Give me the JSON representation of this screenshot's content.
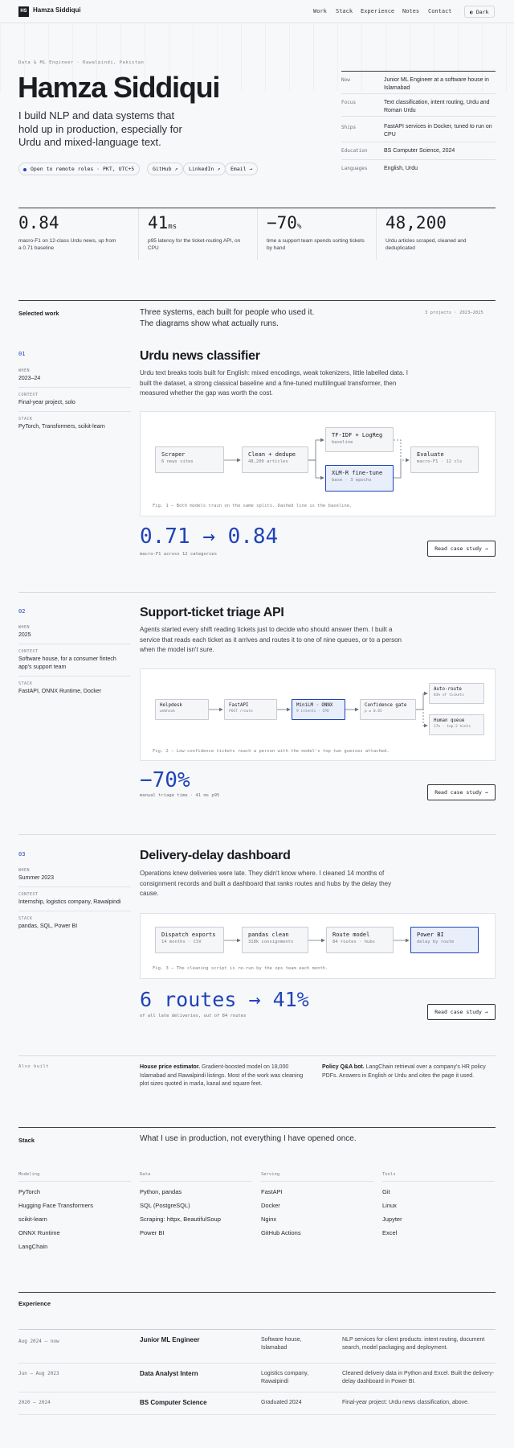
{
  "nav": {
    "logo": "HS",
    "brand": "Hamza Siddiqui",
    "links": [
      "Work",
      "Stack",
      "Experience",
      "Notes",
      "Contact"
    ],
    "theme_toggle": "Dark",
    "active": "Contact"
  },
  "hero": {
    "eyebrow": "Data & ML Engineer · Rawalpindi, Pakistan",
    "name": "Hamza Siddiqui",
    "tagline": "I build NLP and data systems that hold up in production, especially for Urdu and mixed-language text.",
    "status_pill": "Open to remote roles · PKT, UTC+5",
    "links": [
      "GitHub ↗",
      "LinkedIn ↗",
      "Email →"
    ],
    "facts": [
      {
        "k": "Now",
        "v": "Junior ML Engineer at a software house in Islamabad"
      },
      {
        "k": "Focus",
        "v": "Text classification, intent routing, Urdu and Roman Urdu"
      },
      {
        "k": "Ships",
        "v": "FastAPI services in Docker, tuned to run on CPU"
      },
      {
        "k": "Education",
        "v": "BS Computer Science, 2024"
      },
      {
        "k": "Languages",
        "v": "English, Urdu"
      }
    ]
  },
  "stats": [
    {
      "num": "0.84",
      "unit": "",
      "cap": "macro-F1 on 12-class Urdu news, up from a 0.71 baseline"
    },
    {
      "num": "41",
      "unit": "ms",
      "cap": "p95 latency for the ticket-routing API, on CPU"
    },
    {
      "num": "−70",
      "unit": "%",
      "cap": "time a support team spends sorting tickets by hand"
    },
    {
      "num": "48,200",
      "unit": "",
      "cap": "Urdu articles scraped, cleaned and deduplicated"
    }
  ],
  "work": {
    "heading": "Selected work",
    "intro": "Three systems, each built for people who used it. The diagrams show what actually runs.",
    "count": "3 projects · 2023–2025",
    "projects": [
      {
        "num": "01",
        "title": "Urdu news classifier",
        "desc": "Urdu text breaks tools built for English: mixed encodings, weak tokenizers, little labelled data. I built the dataset, a strong classical baseline and a fine-tuned multilingual transformer, then measured whether the gap was worth the cost.",
        "when": "2023–24",
        "context": "Final-year project, solo",
        "stack": "PyTorch, Transformers, scikit-learn",
        "boxes": [
          {
            "t": "Scraper",
            "s": "6 news sites"
          },
          {
            "t": "Clean + dedupe",
            "s": "48,200 articles"
          },
          {
            "t": "TF-IDF + LogReg",
            "s": "baseline"
          },
          {
            "t": "XLM-R fine-tune",
            "s": "base · 3 epochs"
          },
          {
            "t": "Evaluate",
            "s": "macro-F1 · 12 cls"
          }
        ],
        "caption": "Fig. 1 — Both models train on the same splits. Dashed line is the baseline.",
        "result": "0.71 → 0.84",
        "result_cap": "macro-F1 across 12 categories",
        "cta": "Read case study →"
      },
      {
        "num": "02",
        "title": "Support-ticket triage API",
        "desc": "Agents started every shift reading tickets just to decide who should answer them. I built a service that reads each ticket as it arrives and routes it to one of nine queues, or to a person when the model isn't sure.",
        "when": "2025",
        "context": "Software house, for a consumer fintech app's support team",
        "stack": "FastAPI, ONNX Runtime, Docker",
        "boxes": [
          {
            "t": "Helpdesk",
            "s": "webhook"
          },
          {
            "t": "FastAPI",
            "s": "POST /route"
          },
          {
            "t": "MiniLM · ONNX",
            "s": "9 intents · CPU"
          },
          {
            "t": "Confidence gate",
            "s": "p ≥ 0.85"
          },
          {
            "t": "Auto-route",
            "s": "83% of tickets"
          },
          {
            "t": "Human queue",
            "s": "17% · top-2 hints"
          }
        ],
        "caption": "Fig. 2 — Low-confidence tickets reach a person with the model's top two guesses attached.",
        "result": "−70%",
        "result_cap": "manual triage time · 41 ms p95",
        "cta": "Read case study →"
      },
      {
        "num": "03",
        "title": "Delivery-delay dashboard",
        "desc": "Operations knew deliveries were late. They didn't know where. I cleaned 14 months of consignment records and built a dashboard that ranks routes and hubs by the delay they cause.",
        "when": "Summer 2023",
        "context": "Internship, logistics company, Rawalpindi",
        "stack": "pandas, SQL, Power BI",
        "boxes": [
          {
            "t": "Dispatch exports",
            "s": "14 months · CSV"
          },
          {
            "t": "pandas clean",
            "s": "318k consignments"
          },
          {
            "t": "Route model",
            "s": "84 routes · hubs"
          },
          {
            "t": "Power BI",
            "s": "delay by route"
          }
        ],
        "caption": "Fig. 3 — The cleaning script is re-run by the ops team each month.",
        "result": "6 routes → 41%",
        "result_cap": "of all late deliveries, out of 84 routes",
        "cta": "Read case study →"
      }
    ],
    "labels": {
      "when": "WHEN",
      "context": "CONTEXT",
      "stack": "STACK"
    }
  },
  "also": {
    "label": "Also built",
    "items": [
      {
        "title": "House price estimator.",
        "text": "Gradient-boosted model on 18,000 Islamabad and Rawalpindi listings. Most of the work was cleaning plot sizes quoted in marla, kanal and square feet."
      },
      {
        "title": "Policy Q&A bot.",
        "text": "LangChain retrieval over a company's HR policy PDFs. Answers in English or Urdu and cites the page it used."
      }
    ]
  },
  "stack": {
    "heading": "Stack",
    "intro": "What I use in production, not everything I have opened once.",
    "cols": [
      {
        "h": "Modeling",
        "items": [
          "PyTorch",
          "Hugging Face Transformers",
          "scikit-learn",
          "ONNX Runtime",
          "LangChain"
        ]
      },
      {
        "h": "Data",
        "items": [
          "Python, pandas",
          "SQL (PostgreSQL)",
          "Scraping: httpx, BeautifulSoup",
          "Power BI"
        ]
      },
      {
        "h": "Serving",
        "items": [
          "FastAPI",
          "Docker",
          "Nginx",
          "GitHub Actions"
        ]
      },
      {
        "h": "Tools",
        "items": [
          "Git",
          "Linux",
          "Jupyter",
          "Excel"
        ]
      }
    ]
  },
  "experience": {
    "heading": "Experience",
    "rows": [
      {
        "d": "Aug 2024 – now",
        "r": "Junior ML Engineer",
        "p": "Software house, Islamabad",
        "n": "NLP services for client products: intent routing, document search, model packaging and deployment."
      },
      {
        "d": "Jun – Aug 2023",
        "r": "Data Analyst Intern",
        "p": "Logistics company, Rawalpindi",
        "n": "Cleaned delivery data in Python and Excel. Built the delivery-delay dashboard in Power BI."
      },
      {
        "d": "2020 – 2024",
        "r": "BS Computer Science",
        "p": "Graduated 2024",
        "n": "Final-year project: Urdu news classification, above."
      }
    ]
  },
  "colors": {
    "accent": "#2043b8",
    "text": "#1a1c21",
    "bg": "#f7f8fa"
  }
}
